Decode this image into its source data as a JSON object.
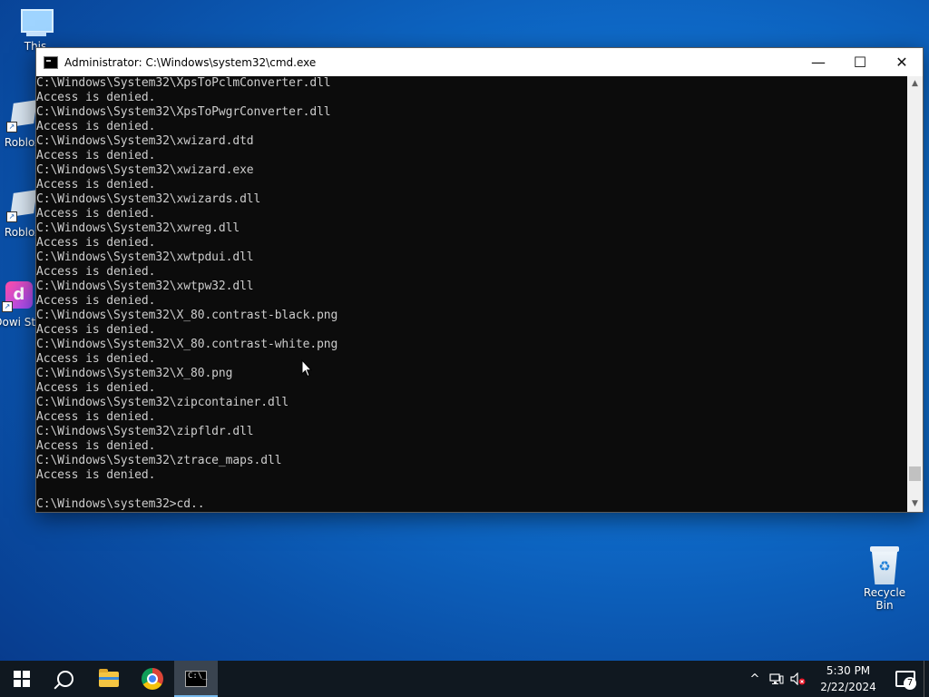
{
  "desktop": {
    "icons": [
      {
        "label": "This"
      },
      {
        "label": "Roblox"
      },
      {
        "label": "Roblox"
      },
      {
        "label": "Dowi Stu"
      }
    ],
    "recycle_bin": {
      "label": "Recycle Bin"
    }
  },
  "window": {
    "title": "Administrator: C:\\Windows\\system32\\cmd.exe",
    "minimize_glyph": "—",
    "maximize_glyph": "☐",
    "close_glyph": "✕"
  },
  "console": {
    "lines": [
      "C:\\Windows\\System32\\XpsToPclmConverter.dll",
      "Access is denied.",
      "C:\\Windows\\System32\\XpsToPwgrConverter.dll",
      "Access is denied.",
      "C:\\Windows\\System32\\xwizard.dtd",
      "Access is denied.",
      "C:\\Windows\\System32\\xwizard.exe",
      "Access is denied.",
      "C:\\Windows\\System32\\xwizards.dll",
      "Access is denied.",
      "C:\\Windows\\System32\\xwreg.dll",
      "Access is denied.",
      "C:\\Windows\\System32\\xwtpdui.dll",
      "Access is denied.",
      "C:\\Windows\\System32\\xwtpw32.dll",
      "Access is denied.",
      "C:\\Windows\\System32\\X_80.contrast-black.png",
      "Access is denied.",
      "C:\\Windows\\System32\\X_80.contrast-white.png",
      "Access is denied.",
      "C:\\Windows\\System32\\X_80.png",
      "Access is denied.",
      "C:\\Windows\\System32\\zipcontainer.dll",
      "Access is denied.",
      "C:\\Windows\\System32\\zipfldr.dll",
      "Access is denied.",
      "C:\\Windows\\System32\\ztrace_maps.dll",
      "Access is denied.",
      "",
      "C:\\Windows\\system32>cd.."
    ]
  },
  "taskbar": {
    "items": [
      {
        "name": "start-button",
        "icon": "windows-logo-icon"
      },
      {
        "name": "search-button",
        "icon": "search-icon"
      },
      {
        "name": "file-explorer-button",
        "icon": "folder-icon"
      },
      {
        "name": "chrome-button",
        "icon": "chrome-icon"
      },
      {
        "name": "cmd-taskbar-button",
        "icon": "cmd-icon",
        "active": true
      }
    ],
    "tray": {
      "chevron": "^",
      "time": "5:30 PM",
      "date": "2/22/2024",
      "notification_count": "7"
    }
  },
  "colors": {
    "console_bg": "#0c0c0c",
    "console_text": "#cccccc",
    "taskbar_bg": "#101820",
    "active_indicator": "#76b9ed"
  }
}
